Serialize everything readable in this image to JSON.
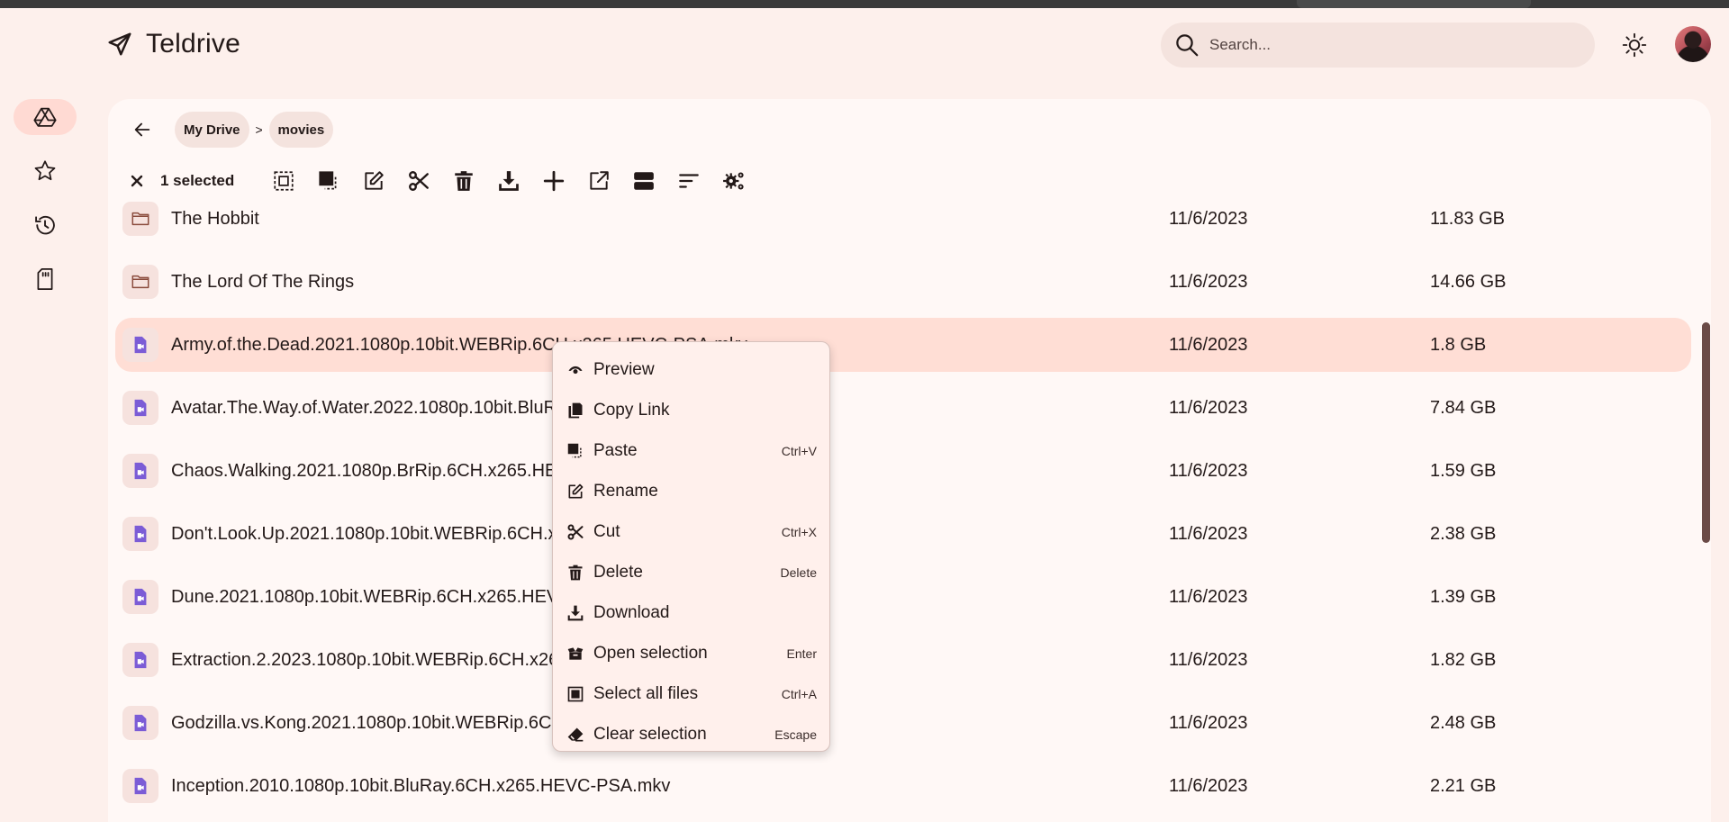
{
  "app": {
    "title": "Teldrive"
  },
  "header": {
    "search_placeholder": "Search...",
    "theme_icon": "sun-icon",
    "avatar_icon": "user-avatar"
  },
  "sidenav": {
    "items": [
      {
        "name": "my-drive",
        "icon": "drive-icon",
        "active": true
      },
      {
        "name": "starred",
        "icon": "star-icon",
        "active": false
      },
      {
        "name": "recent",
        "icon": "history-icon",
        "active": false
      },
      {
        "name": "storage",
        "icon": "sd-card-icon",
        "active": false
      }
    ]
  },
  "breadcrumb": {
    "items": [
      "My Drive",
      "movies"
    ],
    "separator": ">"
  },
  "toolbar": {
    "selected_label": "1 selected",
    "actions": [
      "select-all",
      "paste",
      "rename",
      "cut",
      "delete",
      "download",
      "new",
      "open-external",
      "view-toggle",
      "sort",
      "settings"
    ]
  },
  "files": [
    {
      "name": "The Hobbit",
      "type": "folder",
      "date": "11/6/2023",
      "size": "11.83 GB"
    },
    {
      "name": "The Lord Of The Rings",
      "type": "folder",
      "date": "11/6/2023",
      "size": "14.66 GB"
    },
    {
      "name": "Army.of.the.Dead.2021.1080p.10bit.WEBRip.6CH.x265.HEVC-PSA.mkv",
      "type": "video",
      "date": "11/6/2023",
      "size": "1.8 GB",
      "selected": true
    },
    {
      "name": "Avatar.The.Way.of.Water.2022.1080p.10bit.BluRay.6CH.x265.HEVC-PSA.mkv",
      "type": "video",
      "date": "11/6/2023",
      "size": "7.84 GB"
    },
    {
      "name": "Chaos.Walking.2021.1080p.BrRip.6CH.x265.HEVC-PSA.mkv",
      "type": "video",
      "date": "11/6/2023",
      "size": "1.59 GB"
    },
    {
      "name": "Don't.Look.Up.2021.1080p.10bit.WEBRip.6CH.x265.HEVC-PSA.mkv",
      "type": "video",
      "date": "11/6/2023",
      "size": "2.38 GB"
    },
    {
      "name": "Dune.2021.1080p.10bit.WEBRip.6CH.x265.HEVC-PSA.mkv",
      "type": "video",
      "date": "11/6/2023",
      "size": "1.39 GB"
    },
    {
      "name": "Extraction.2.2023.1080p.10bit.WEBRip.6CH.x265.HEVC-PSA.mkv",
      "type": "video",
      "date": "11/6/2023",
      "size": "1.82 GB"
    },
    {
      "name": "Godzilla.vs.Kong.2021.1080p.10bit.WEBRip.6CH.x265.HEVC-PSA.mkv",
      "type": "video",
      "date": "11/6/2023",
      "size": "2.48 GB"
    },
    {
      "name": "Inception.2010.1080p.10bit.BluRay.6CH.x265.HEVC-PSA.mkv",
      "type": "video",
      "date": "11/6/2023",
      "size": "2.21 GB"
    }
  ],
  "context_menu": {
    "items": [
      {
        "label": "Preview",
        "shortcut": "",
        "icon": "eye-icon"
      },
      {
        "label": "Copy Link",
        "shortcut": "",
        "icon": "copy-icon"
      },
      {
        "label": "Paste",
        "shortcut": "Ctrl+V",
        "icon": "paste-icon"
      },
      {
        "label": "Rename",
        "shortcut": "",
        "icon": "edit-icon"
      },
      {
        "label": "Cut",
        "shortcut": "Ctrl+X",
        "icon": "scissors-icon"
      },
      {
        "label": "Delete",
        "shortcut": "Delete",
        "icon": "trash-icon"
      },
      {
        "label": "Download",
        "shortcut": "",
        "icon": "download-icon"
      },
      {
        "label": "Open selection",
        "shortcut": "Enter",
        "icon": "open-box-icon"
      },
      {
        "label": "Select all files",
        "shortcut": "Ctrl+A",
        "icon": "select-all-icon"
      },
      {
        "label": "Clear selection",
        "shortcut": "Escape",
        "icon": "eraser-icon"
      }
    ]
  },
  "colors": {
    "background": "#fdf0ec",
    "panel": "#fff8f6",
    "selected_row": "#ffded5",
    "video_icon": "#7b5cd6",
    "folder_icon": "#8a4b3c"
  }
}
